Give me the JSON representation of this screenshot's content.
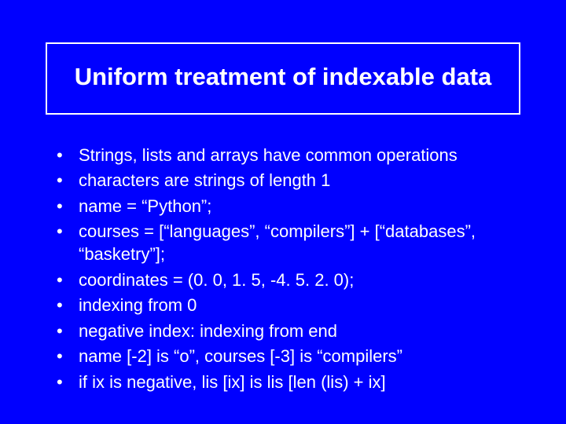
{
  "title": "Uniform treatment of indexable data",
  "bullets": [
    "Strings, lists and arrays have common operations",
    "characters are strings of length 1",
    "name = “Python”;",
    "courses = [“languages”, “compilers”] + [“databases”, “basketry”];",
    "coordinates = (0. 0, 1. 5, -4. 5. 2. 0);",
    "indexing from 0",
    "negative index: indexing from end",
    "name [-2]  is “o”, courses [-3] is “compilers”",
    "if ix is negative, lis [ix]  is lis [len (lis) + ix]"
  ]
}
